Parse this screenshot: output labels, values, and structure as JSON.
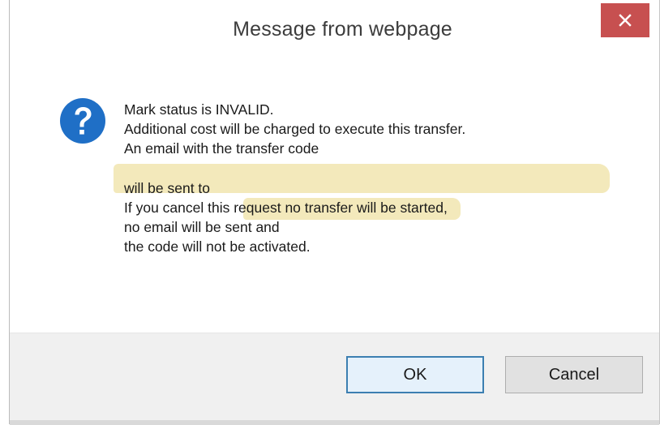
{
  "dialog": {
    "title": "Message from webpage",
    "close_icon": "close-icon",
    "icon": "question-icon",
    "message_lines": [
      "Mark status is INVALID.",
      "Additional cost will be charged to execute this transfer.",
      "An email with the transfer code",
      "",
      "will be sent to",
      "If you cancel this request no transfer will be started,",
      "no email will be sent and",
      "the code will not be activated."
    ],
    "buttons": {
      "ok_label": "OK",
      "cancel_label": "Cancel"
    }
  },
  "colors": {
    "close_button": "#c75050",
    "icon_blue": "#1f6fc6",
    "redaction": "#f3e9bb",
    "ok_border": "#3c7fb1"
  }
}
